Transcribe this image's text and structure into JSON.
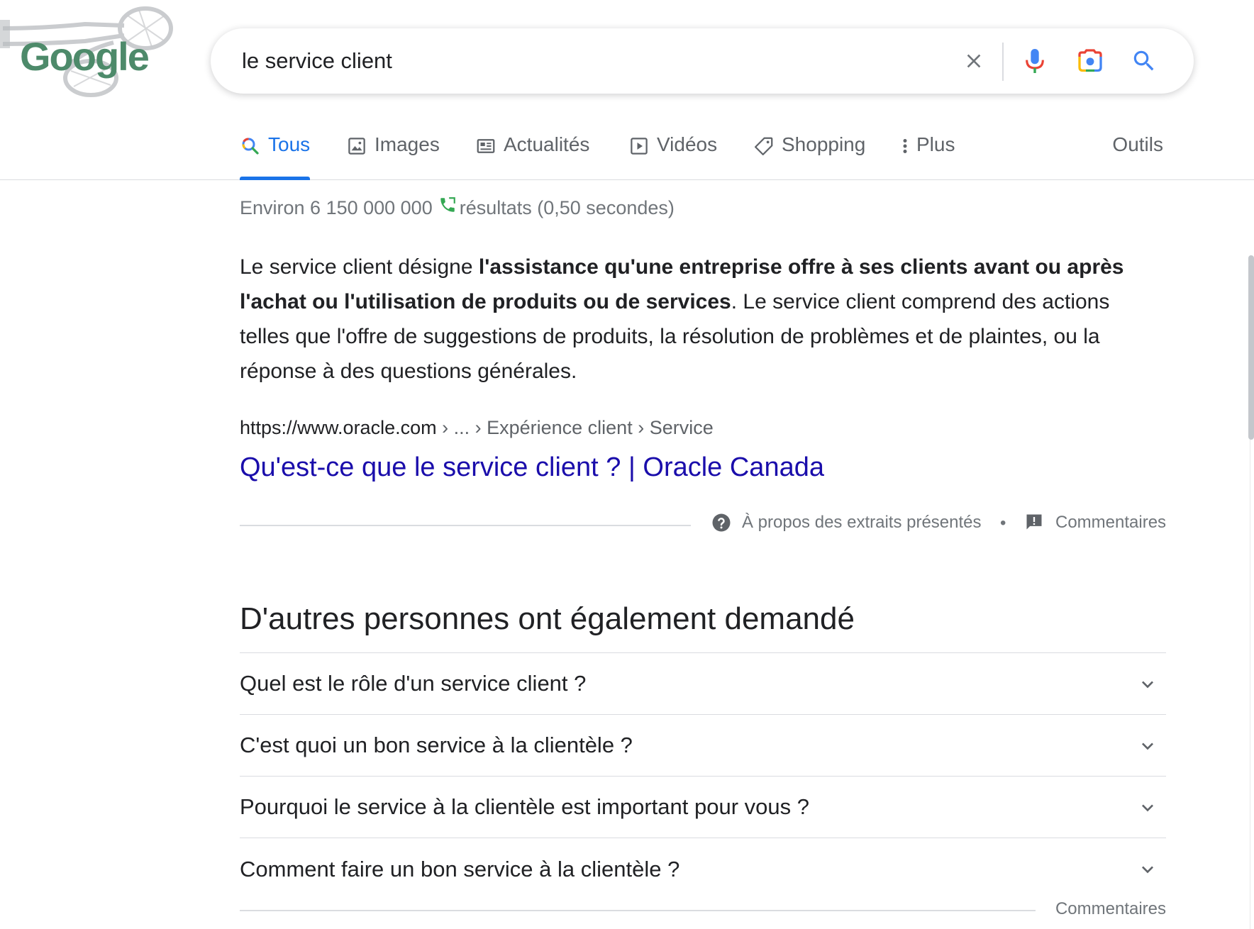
{
  "logo": {
    "text": "Google",
    "description": "doodle-snowshoes"
  },
  "search": {
    "query": "le service client",
    "icons": [
      "close-icon",
      "microphone-icon",
      "camera-lens-icon",
      "search-icon"
    ]
  },
  "tabs": [
    {
      "label": "Tous",
      "icon": "search-icon",
      "active": true
    },
    {
      "label": "Images",
      "icon": "image-icon",
      "active": false
    },
    {
      "label": "Actualités",
      "icon": "news-icon",
      "active": false
    },
    {
      "label": "Vidéos",
      "icon": "video-icon",
      "active": false
    },
    {
      "label": "Shopping",
      "icon": "tag-icon",
      "active": false
    },
    {
      "label": "Plus",
      "icon": "more-vert-icon",
      "active": false
    }
  ],
  "tools_label": "Outils",
  "stats": {
    "prefix": "Environ 6 150 000 000",
    "suffix": "résultats (0,50 secondes)"
  },
  "featured_snippet": {
    "text_1": "Le service client désigne ",
    "bold": "l'assistance qu'une entreprise offre à ses clients avant ou après l'achat ou l'utilisation de produits ou de services",
    "text_2": ". Le service client comprend des actions telles que l'offre de suggestions de produits, la résolution de problèmes et de plaintes, ou la réponse à des questions générales.",
    "cite_domain": "https://www.oracle.com",
    "cite_crumbs": " › ... › Expérience client › Service",
    "title": "Qu'est-ce que le service client ? | Oracle Canada",
    "about_label": "À propos des extraits présentés",
    "separator": "•",
    "feedback_label": "Commentaires"
  },
  "people_also_ask": {
    "heading": "D'autres personnes ont également demandé",
    "questions": [
      "Quel est le rôle d'un service client ?",
      "C'est quoi un bon service à la clientèle ?",
      "Pourquoi le service à la clientèle est important pour vous ?",
      "Comment faire un bon service à la clientèle ?"
    ],
    "feedback_label": "Commentaires"
  },
  "colors": {
    "link": "#1a0dab",
    "active_tab": "#1a73e8",
    "muted": "#70757a",
    "text": "#202124"
  }
}
